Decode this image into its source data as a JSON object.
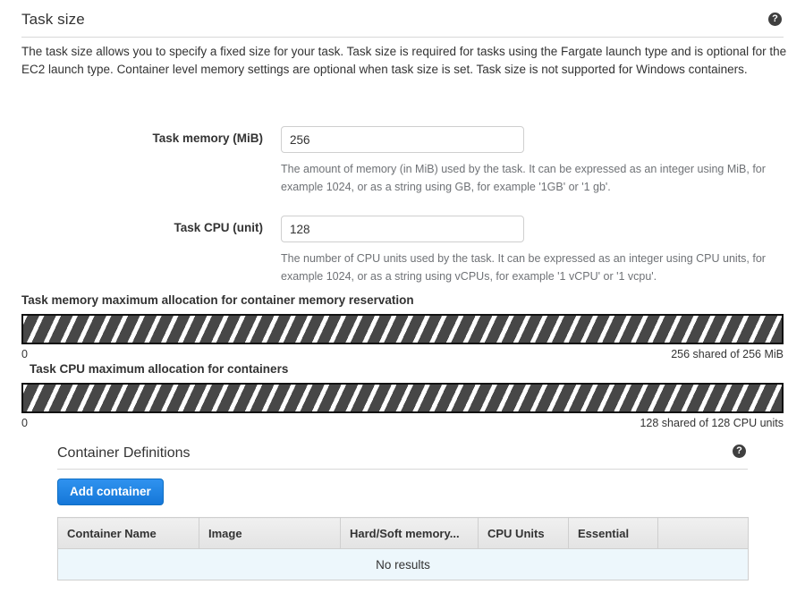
{
  "section": {
    "title": "Task size",
    "help_icon": "help-circle-icon",
    "description": "The task size allows you to specify a fixed size for your task. Task size is required for tasks using the Fargate launch type and is optional for the EC2 launch type. Container level memory settings are optional when task size is set. Task size is not supported for Windows containers."
  },
  "form": {
    "task_memory": {
      "label": "Task memory (MiB)",
      "value": "256",
      "placeholder": "",
      "helper": "The amount of memory (in MiB) used by the task. It can be expressed as an integer using MiB, for example 1024, or as a string using GB, for example '1GB' or '1 gb'."
    },
    "task_cpu": {
      "label": "Task CPU (unit)",
      "value": "128",
      "placeholder": "",
      "helper": "The number of CPU units used by the task. It can be expressed as an integer using CPU units, for example 1024, or as a string using vCPUs, for example '1 vCPU' or '1 vcpu'."
    }
  },
  "allocation": {
    "memory": {
      "label": "Task memory maximum allocation for container memory reservation",
      "min_label": "0",
      "max_label": "256 shared of 256 MiB",
      "shared": 256,
      "total": 256,
      "unit": "MiB",
      "fill_percent": 100
    },
    "cpu": {
      "label": "Task CPU maximum allocation for containers",
      "min_label": "0",
      "max_label": "128 shared of 128 CPU units",
      "shared": 128,
      "total": 128,
      "unit": "CPU units",
      "fill_percent": 100
    }
  },
  "container_definitions": {
    "title": "Container Definitions",
    "help_icon": "help-circle-icon",
    "add_button": "Add container",
    "columns": [
      "Container Name",
      "Image",
      "Hard/Soft memory...",
      "CPU Units",
      "Essential",
      ""
    ],
    "rows": [],
    "empty_message": "No results"
  },
  "colors": {
    "accent_blue": "#1577d8",
    "stripe_dark": "#474747",
    "empty_row_bg": "#edf7fc",
    "helper_text": "#6f7276"
  }
}
